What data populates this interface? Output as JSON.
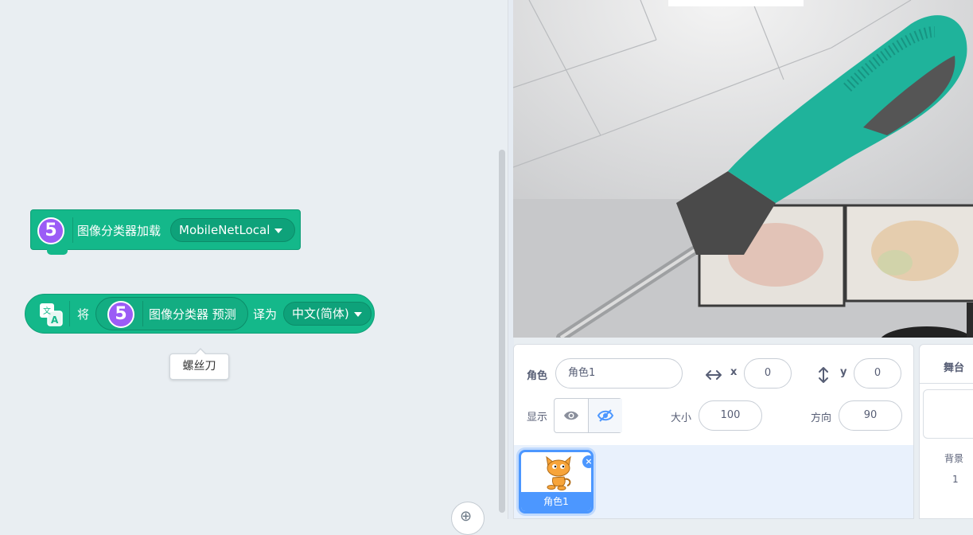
{
  "blocks": {
    "load": {
      "ext_number": "5",
      "label": "图像分类器加载",
      "model": "MobileNetLocal"
    },
    "translate": {
      "word_jiang": "将",
      "ext_number": "5",
      "reporter_label": "图像分类器 预测",
      "word_to": "译为",
      "language": "中文(简体)"
    },
    "tooltip": "螺丝刀"
  },
  "sprite_info": {
    "sprite_label": "角色",
    "sprite_name": "角色1",
    "x_label": "x",
    "x_value": "0",
    "y_label": "y",
    "y_value": "0",
    "show_label": "显示",
    "size_label": "大小",
    "size_value": "100",
    "direction_label": "方向",
    "direction_value": "90"
  },
  "sprites": [
    {
      "name": "角色1"
    }
  ],
  "stage_panel": {
    "title": "舞台",
    "backdrops_label": "背景",
    "backdrops_count": "1"
  },
  "colors": {
    "block_green": "#14b88a",
    "extension_purple": "#9b5cf6",
    "selected_blue": "#4c97ff"
  },
  "icons": [
    "translate-icon",
    "eye-icon",
    "eye-off-icon",
    "arrows-horizontal-icon",
    "arrows-vertical-icon",
    "zoom-in-icon",
    "close-icon"
  ]
}
